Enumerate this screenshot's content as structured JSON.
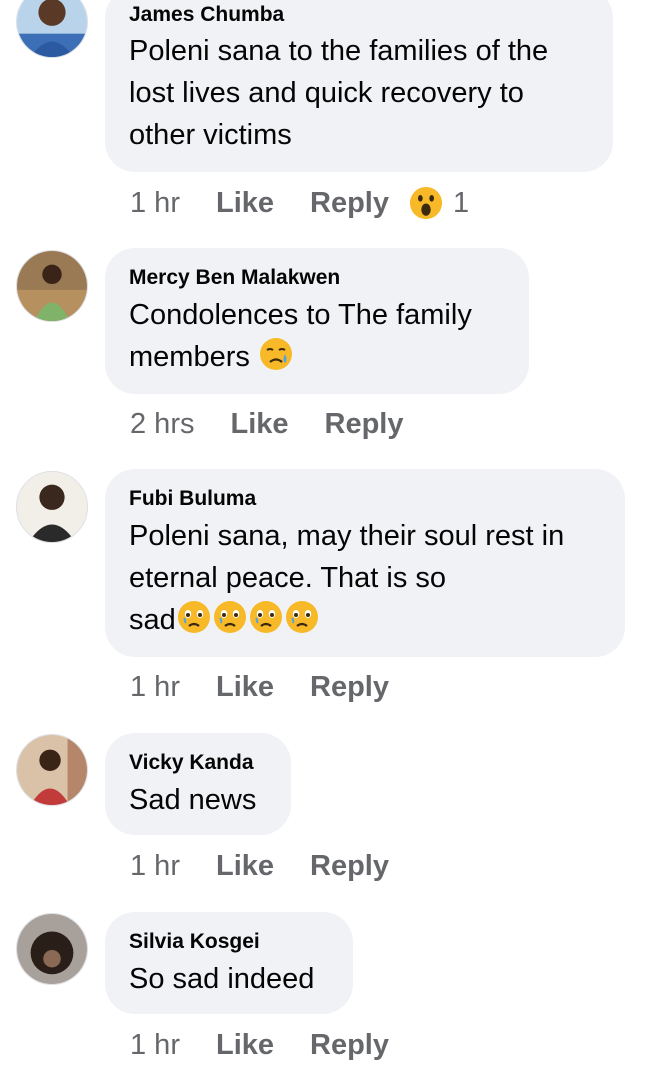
{
  "comments": [
    {
      "author": "James Chumba",
      "lines": [
        "Poleni sana to the families of the",
        "lost lives and quick recovery to",
        "other victims"
      ],
      "time": "1 hr",
      "like": "Like",
      "reply": "Reply",
      "reaction": {
        "icon": "wow-icon",
        "count": "1"
      }
    },
    {
      "author": "Mercy Ben Malakwen",
      "lines": [
        "Condolences to The family",
        "members"
      ],
      "emoji": "sad-tear-icon",
      "time": "2 hrs",
      "like": "Like",
      "reply": "Reply"
    },
    {
      "author": "Fubi Buluma",
      "lines": [
        "Poleni sana, may their soul rest in",
        "eternal peace. That is so",
        "sad"
      ],
      "emoji": "holding-back-tears-icon",
      "time": "1 hr",
      "like": "Like",
      "reply": "Reply"
    },
    {
      "author": "Vicky Kanda",
      "lines": [
        "Sad news"
      ],
      "time": "1 hr",
      "like": "Like",
      "reply": "Reply"
    },
    {
      "author": "Silvia Kosgei",
      "lines": [
        "So sad indeed"
      ],
      "time": "1 hr",
      "like": "Like",
      "reply": "Reply"
    }
  ],
  "colors": {
    "bubble": "#f0f2f5",
    "meta": "#65676b",
    "text": "#050505"
  }
}
